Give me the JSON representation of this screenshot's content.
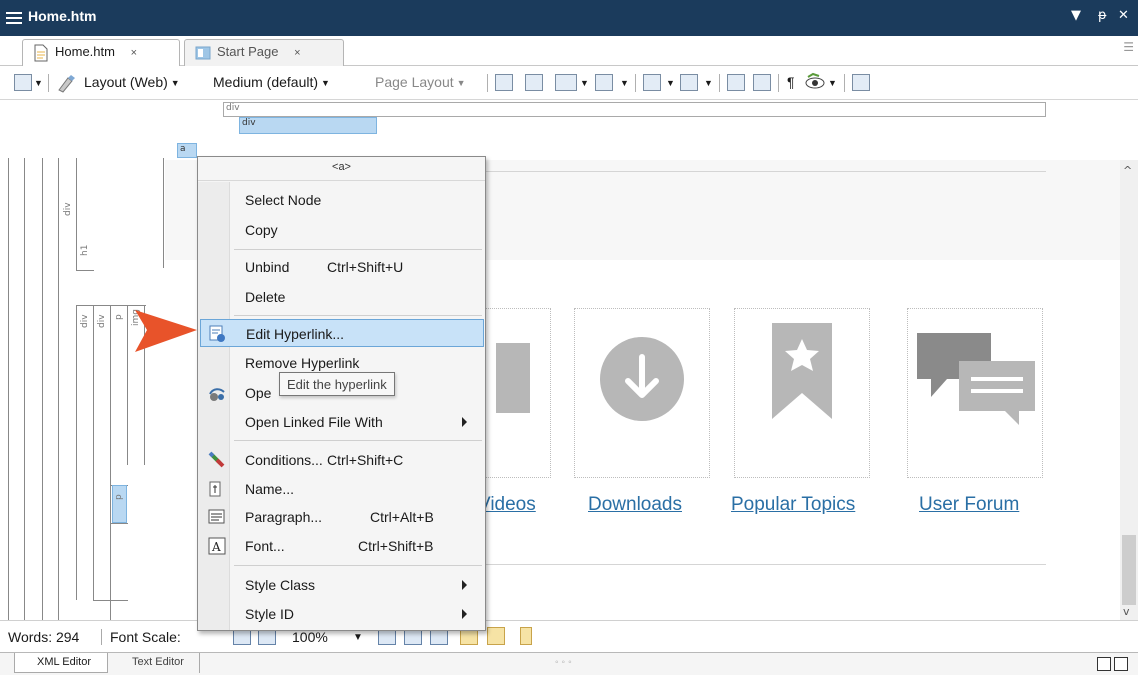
{
  "window": {
    "title": "Home.htm",
    "pin_glyph": "▾  Θ  ✕"
  },
  "tabs": [
    {
      "label": "Home.htm",
      "close": "×"
    },
    {
      "label": "Start Page",
      "close": "×"
    }
  ],
  "toolbar": {
    "layout": "Layout (Web)",
    "medium": "Medium (default)",
    "page_layout": "Page Layout",
    "pilcrow": "¶"
  },
  "structure_bar": {
    "outer": "div",
    "inner": "div",
    "anchor": "a",
    "tags": {
      "div1": "div",
      "h1": "h1",
      "div2": "div",
      "div3": "div",
      "p1": "p",
      "img": "img",
      "p2": "p"
    }
  },
  "content": {
    "tiles": [
      {
        "label": "Videos",
        "icon": "video-icon"
      },
      {
        "label": "Downloads",
        "icon": "download-icon"
      },
      {
        "label": "Popular Topics",
        "icon": "bookmark-star-icon"
      },
      {
        "label": "User Forum",
        "icon": "chat-bubbles-icon"
      }
    ],
    "tile_color": "#b7b7b7",
    "link_color": "#2a6fa5"
  },
  "context_menu": {
    "header": "<a>",
    "items": [
      {
        "label": "Select Node",
        "shortcut": ""
      },
      {
        "label": "Copy",
        "shortcut": ""
      },
      {
        "label": "Unbind",
        "shortcut": "Ctrl+Shift+U"
      },
      {
        "label": "Delete",
        "shortcut": ""
      },
      {
        "label": "Edit Hyperlink...",
        "shortcut": "",
        "highlighted": true
      },
      {
        "label": "Remove Hyperlink",
        "shortcut": ""
      },
      {
        "label": "Ope",
        "shortcut": ""
      },
      {
        "label": "Open Linked File With",
        "shortcut": "",
        "submenu": true
      },
      {
        "label": "Conditions...",
        "shortcut": "Ctrl+Shift+C"
      },
      {
        "label": "Name...",
        "shortcut": ""
      },
      {
        "label": "Paragraph...",
        "shortcut": "Ctrl+Alt+B"
      },
      {
        "label": "Font...",
        "shortcut": "Ctrl+Shift+B"
      },
      {
        "label": "Style Class",
        "shortcut": "",
        "submenu": true
      },
      {
        "label": "Style ID",
        "shortcut": "",
        "submenu": true
      }
    ],
    "highlight_color": "#c8e2f8"
  },
  "tooltip": "Edit the hyperlink",
  "callout_color": "#e8532a",
  "status": {
    "words": "Words: 294",
    "font_scale_label": "Font Scale:",
    "zoom": "100%"
  },
  "bottom_tabs": {
    "xml": "XML Editor",
    "text": "Text Editor",
    "dots": "◦◦◦"
  }
}
